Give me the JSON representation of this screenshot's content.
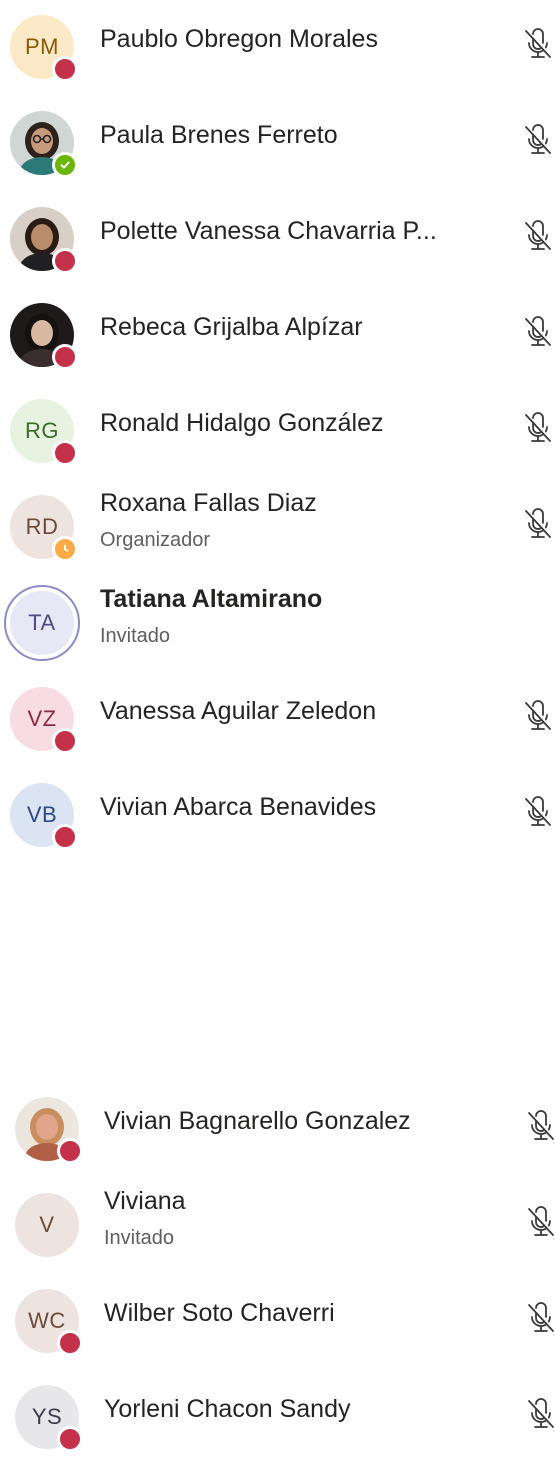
{
  "participants_top": [
    {
      "initials": "PM",
      "name": "Paublo Obregon Morales",
      "subtitle": "",
      "avatar_bg": "#fbe9c7",
      "avatar_fg": "#8a5a00",
      "status": "busy",
      "muted": true
    },
    {
      "initials": "",
      "name": "Paula Brenes Ferreto",
      "subtitle": "",
      "photo": "woman-glasses",
      "status": "available",
      "muted": true
    },
    {
      "initials": "",
      "name": "Polette Vanessa Chavarria P...",
      "subtitle": "",
      "photo": "woman-dark",
      "status": "busy",
      "muted": true
    },
    {
      "initials": "",
      "name": "Rebeca Grijalba Alpízar",
      "subtitle": "",
      "photo": "woman-hair",
      "status": "busy",
      "muted": true
    },
    {
      "initials": "RG",
      "name": "Ronald Hidalgo González",
      "subtitle": "",
      "avatar_bg": "#e7f2e1",
      "avatar_fg": "#3a6b28",
      "status": "busy",
      "muted": true
    },
    {
      "initials": "RD",
      "name": "Roxana Fallas Diaz",
      "subtitle": "Organizador",
      "avatar_bg": "#eee4df",
      "avatar_fg": "#6a4a3a",
      "status": "away",
      "muted": true
    },
    {
      "initials": "TA",
      "name": "Tatiana Altamirano",
      "subtitle": "Invitado",
      "avatar_bg": "#e8e7f5",
      "avatar_fg": "#4f4b8a",
      "status": "none",
      "muted": false,
      "bold": true,
      "ring": true
    },
    {
      "initials": "VZ",
      "name": "Vanessa Aguilar Zeledon",
      "subtitle": "",
      "avatar_bg": "#f8dce3",
      "avatar_fg": "#8a2a42",
      "status": "busy",
      "muted": true
    },
    {
      "initials": "VB",
      "name": "Vivian Abarca Benavides",
      "subtitle": "",
      "avatar_bg": "#dbe4f3",
      "avatar_fg": "#2c4a80",
      "status": "busy",
      "muted": true
    }
  ],
  "participants_bottom": [
    {
      "initials": "",
      "name": "Vivian Bagnarello Gonzalez",
      "subtitle": "",
      "photo": "woman-blonde",
      "status": "busy",
      "muted": true
    },
    {
      "initials": "V",
      "name": "Viviana",
      "subtitle": "Invitado",
      "avatar_bg": "#eee4df",
      "avatar_fg": "#6a4a3a",
      "status": "none",
      "muted": true
    },
    {
      "initials": "WC",
      "name": "Wilber Soto Chaverri",
      "subtitle": "",
      "avatar_bg": "#eee4df",
      "avatar_fg": "#6a4a3a",
      "status": "busy",
      "muted": true
    },
    {
      "initials": "YS",
      "name": "Yorleni Chacon Sandy",
      "subtitle": "",
      "avatar_bg": "#e7e7ea",
      "avatar_fg": "#3a3a4a",
      "status": "busy",
      "muted": true
    }
  ],
  "status_colors": {
    "busy": "#c4314b",
    "available": "#6bb700",
    "away": "#ffaa44"
  },
  "icons": {
    "mute": "mic-off-icon",
    "busy": "busy-dot-icon",
    "available": "check-circle-icon",
    "away": "clock-icon"
  }
}
